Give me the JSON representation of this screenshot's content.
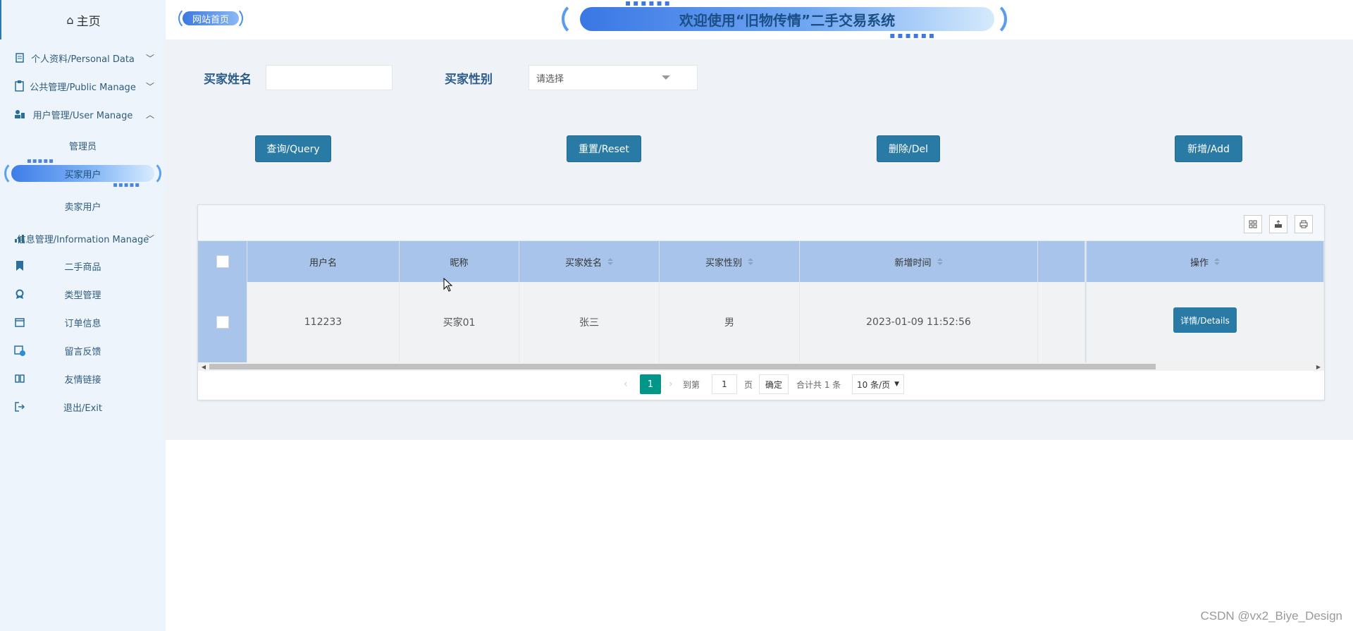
{
  "sidebar": {
    "home_label": "主页",
    "items": [
      {
        "label": "个人资料/Personal Data",
        "icon": "profile-icon"
      },
      {
        "label": "公共管理/Public Manage",
        "icon": "clipboard-icon"
      },
      {
        "label": "用户管理/User Manage",
        "icon": "users-icon"
      },
      {
        "label": "信息管理/Information Manage",
        "icon": "chart-icon"
      }
    ],
    "user_sub": [
      "管理员",
      "买家用户",
      "卖家用户"
    ],
    "info_sub": [
      {
        "label": "二手商品",
        "icon": "bookmark-icon"
      },
      {
        "label": "类型管理",
        "icon": "badge-icon"
      },
      {
        "label": "订单信息",
        "icon": "calendar-icon"
      },
      {
        "label": "留言反馈",
        "icon": "calendar-check-icon"
      },
      {
        "label": "友情链接",
        "icon": "book-icon"
      },
      {
        "label": "退出/Exit",
        "icon": "exit-icon"
      }
    ]
  },
  "header": {
    "site_home": "网站首页",
    "banner": "欢迎使用“旧物传情”二手交易系统"
  },
  "search": {
    "name_label": "买家姓名",
    "name_value": "",
    "gender_label": "买家性别",
    "gender_value": "请选择"
  },
  "actions": {
    "query": "查询/Query",
    "reset": "重置/Reset",
    "delete": "删除/Del",
    "add": "新增/Add"
  },
  "table": {
    "columns": [
      "用户名",
      "昵称",
      "买家姓名",
      "买家性别",
      "新增时间",
      "操作"
    ],
    "rows": [
      {
        "username": "112233",
        "nickname": "买家01",
        "name": "张三",
        "gender": "男",
        "created": "2023-01-09 11:52:56",
        "action": "详情/Details"
      }
    ]
  },
  "pager": {
    "current": "1",
    "goto_label": "到第",
    "page_input": "1",
    "page_unit": "页",
    "confirm": "确定",
    "total": "合计共 1 条",
    "per_page": "10 条/页"
  },
  "watermark": "CSDN @vx2_Biye_Design"
}
